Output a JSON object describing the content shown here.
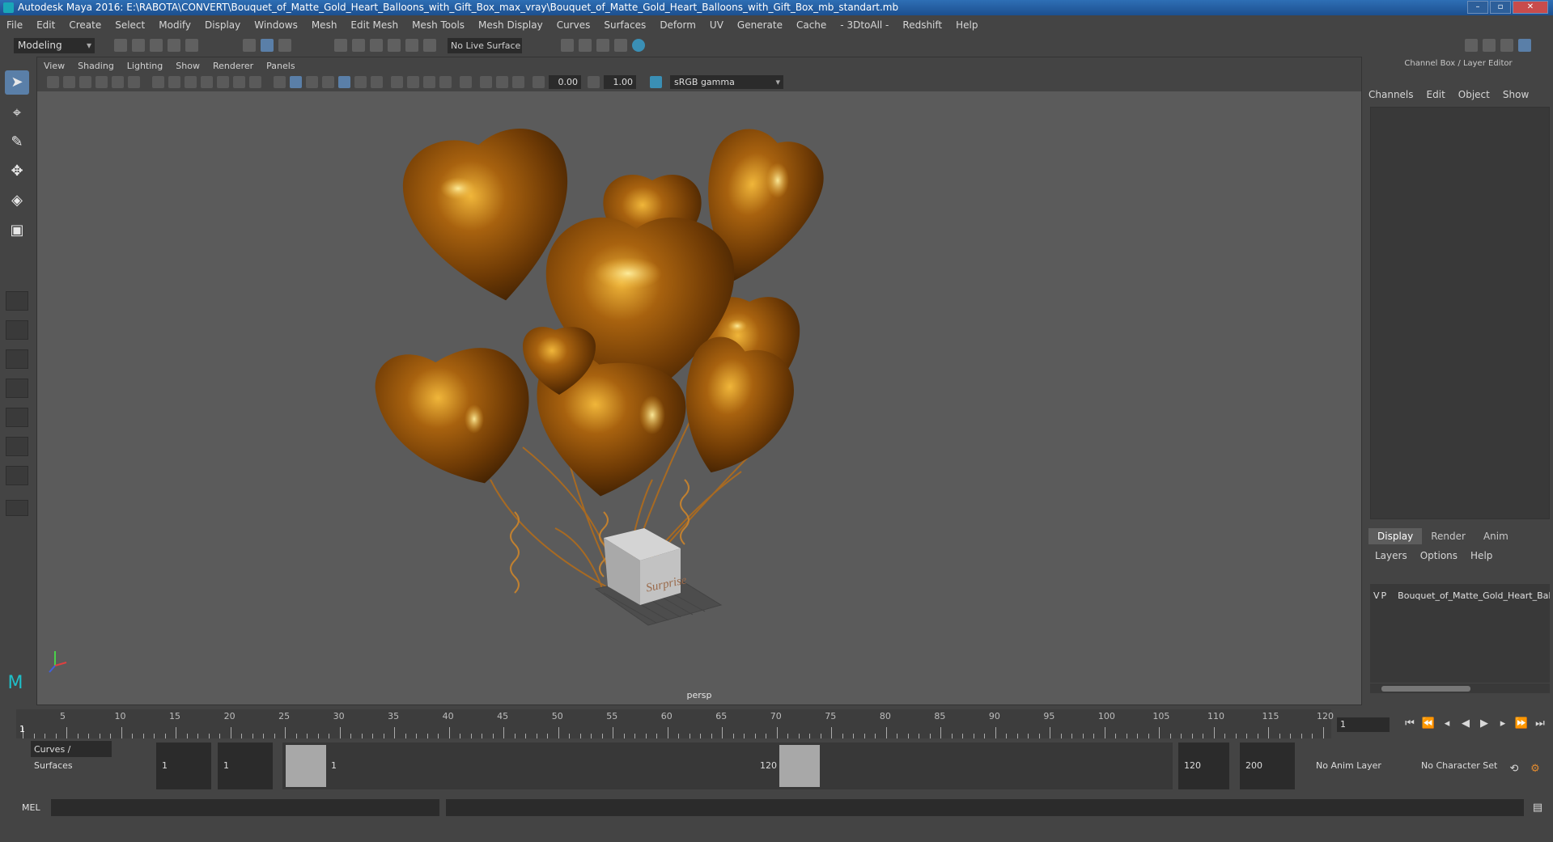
{
  "window": {
    "title": "Autodesk Maya 2016: E:\\RABOTA\\CONVERT\\Bouquet_of_Matte_Gold_Heart_Balloons_with_Gift_Box_max_vray\\Bouquet_of_Matte_Gold_Heart_Balloons_with_Gift_Box_mb_standart.mb"
  },
  "menubar": [
    "File",
    "Edit",
    "Create",
    "Select",
    "Modify",
    "Display",
    "Windows",
    "Mesh",
    "Edit Mesh",
    "Mesh Tools",
    "Mesh Display",
    "Curves",
    "Surfaces",
    "Deform",
    "UV",
    "Generate",
    "Cache",
    "- 3DtoAll -",
    "Redshift",
    "Help"
  ],
  "statusline": {
    "mode": "Modeling",
    "live_surface": "No Live Surface"
  },
  "viewport": {
    "menu": [
      "View",
      "Shading",
      "Lighting",
      "Show",
      "Renderer",
      "Panels"
    ],
    "exposure": "0.00",
    "gamma": "1.00",
    "colorspace": "sRGB gamma",
    "camera_label": "persp",
    "gift_box_text": "Surprise"
  },
  "channelbox": {
    "title": "Channel Box / Layer Editor",
    "menu": [
      "Channels",
      "Edit",
      "Object",
      "Show"
    ],
    "layer_tabs": [
      "Display",
      "Render",
      "Anim"
    ],
    "layer_menu": [
      "Layers",
      "Options",
      "Help"
    ],
    "layer": {
      "v": "V",
      "p": "P",
      "name": "Bouquet_of_Matte_Gold_Heart_Balloons_with_Gift_Box",
      "color": "#b8123b"
    }
  },
  "timeline": {
    "ticks": [
      "1",
      "5",
      "10",
      "15",
      "20",
      "25",
      "30",
      "35",
      "40",
      "45",
      "50",
      "55",
      "60",
      "65",
      "70",
      "75",
      "80",
      "85",
      "90",
      "95",
      "100",
      "105",
      "110",
      "115",
      "120"
    ],
    "current_frame": "1"
  },
  "range": {
    "shelf_tab": "Curves / Surfaces",
    "start_time": "1",
    "playback_start": "1",
    "slider_start": "1",
    "slider_end": "120",
    "playback_end": "120",
    "end_time": "200",
    "anim_layer": "No Anim Layer",
    "character_set": "No Character Set"
  },
  "cmdline": {
    "label": "MEL"
  }
}
